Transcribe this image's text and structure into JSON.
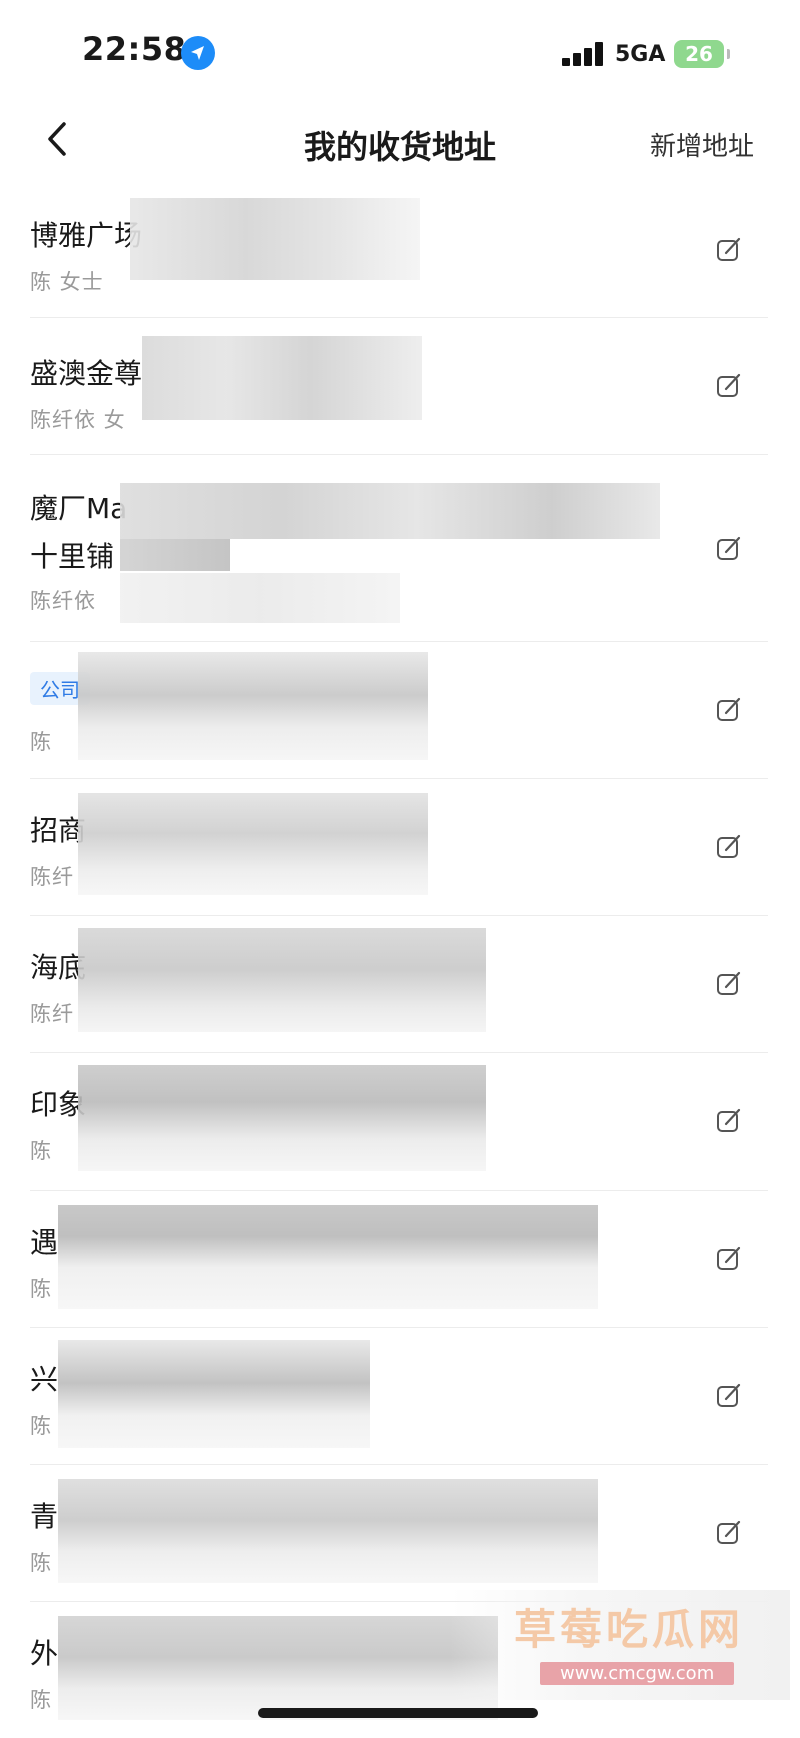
{
  "status": {
    "time": "22:58",
    "network": "5GA",
    "battery": "26"
  },
  "nav": {
    "title": "我的收货地址",
    "add_label": "新增地址"
  },
  "addresses": [
    {
      "line1": "博雅广场",
      "meta": "陈 女士"
    },
    {
      "line1": "盛澳金尊",
      "meta": "陈纤依 女"
    },
    {
      "line1": "魔厂Ma",
      "line2": "十里铺",
      "meta": "陈纤依"
    },
    {
      "tag": "公司",
      "meta": "陈"
    },
    {
      "line1": "招商",
      "meta": "陈纤"
    },
    {
      "line1": "海底",
      "meta": "陈纤"
    },
    {
      "line1": "印象",
      "meta": "陈"
    },
    {
      "line1": "遇",
      "meta": "陈"
    },
    {
      "line1": "兴",
      "meta": "陈"
    },
    {
      "line1": "青",
      "meta": "陈"
    },
    {
      "line1": "外",
      "meta": "陈"
    }
  ],
  "watermark": {
    "title": "草莓吃瓜网",
    "url": "www.cmcgw.com"
  },
  "icons": {
    "back": "chevron-left-icon",
    "edit": "edit-icon",
    "location": "location-arrow-icon"
  },
  "colors": {
    "accent": "#1d8cf8",
    "battery": "#8fd88e",
    "tag_bg": "#e8f2fd",
    "tag_text": "#2f7be5"
  }
}
